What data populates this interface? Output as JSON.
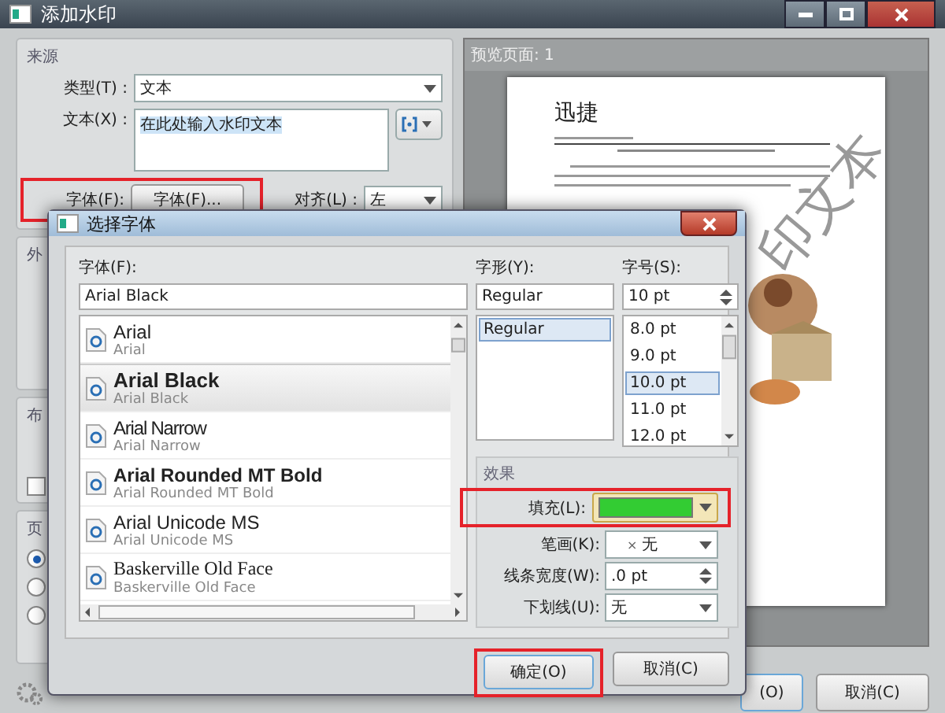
{
  "window": {
    "title": "添加水印"
  },
  "source": {
    "title": "来源",
    "type_label": "类型(T) :",
    "type_value": "文本",
    "text_label": "文本(X) :",
    "text_value": "在此处输入水印文本",
    "font_label": "字体(F):",
    "font_button": "字体(F)...",
    "font_highlighted": true,
    "align_label": "对齐(L) :",
    "align_value": "左"
  },
  "left_groups": [
    {
      "title": "外"
    },
    {
      "title": "布",
      "checkbox_checked": false
    },
    {
      "title": "页",
      "radios": [
        {
          "selected": true
        },
        {
          "selected": false
        },
        {
          "selected": false
        }
      ]
    }
  ],
  "preview": {
    "title": "预览页面: 1",
    "doc_title": "迅捷",
    "watermark": "印文本"
  },
  "buttons": [
    {
      "label": "(O)"
    },
    {
      "label": "取消(C)"
    }
  ],
  "font_dialog": {
    "title": "选择字体",
    "font_label": "字体(F):",
    "font_value": "Arial Black",
    "fonts": [
      {
        "name": "Arial",
        "sample": "Arial",
        "kind": "regular",
        "selected": false
      },
      {
        "name": "Arial Black",
        "sample": "Arial Black",
        "kind": "black",
        "selected": true
      },
      {
        "name": "Arial Narrow",
        "sample": "Arial Narrow",
        "kind": "narrow",
        "selected": false
      },
      {
        "name": "Arial Rounded MT Bold",
        "sample": "Arial Rounded MT Bold",
        "kind": "bold",
        "selected": false
      },
      {
        "name": "Arial Unicode MS",
        "sample": "Arial Unicode MS",
        "kind": "regular",
        "selected": false
      },
      {
        "name": "Baskerville Old Face",
        "sample": "Baskerville Old Face",
        "kind": "serif",
        "selected": false
      }
    ],
    "style_label": "字形(Y):",
    "style_value": "Regular",
    "styles": [
      {
        "label": "Regular",
        "selected": true
      }
    ],
    "size_label": "字号(S):",
    "size_value": "10 pt",
    "sizes": [
      {
        "label": "8.0 pt",
        "selected": false
      },
      {
        "label": "9.0 pt",
        "selected": false
      },
      {
        "label": "10.0 pt",
        "selected": true
      },
      {
        "label": "11.0 pt",
        "selected": false
      },
      {
        "label": "12.0 pt",
        "selected": false
      }
    ],
    "effects": {
      "title": "效果",
      "fill": {
        "label": "填充(L):",
        "color": "#33cc33",
        "highlighted": true
      },
      "stroke_label": "笔画(K):",
      "stroke_mark": "×",
      "stroke_value": "无",
      "width_label": "线条宽度(W):",
      "width_value": ".0 pt",
      "underline_label": "下划线(U):",
      "underline_value": "无"
    },
    "ok": {
      "label": "确定(O)",
      "highlighted": true
    },
    "cancel": {
      "label": "取消(C)"
    }
  }
}
